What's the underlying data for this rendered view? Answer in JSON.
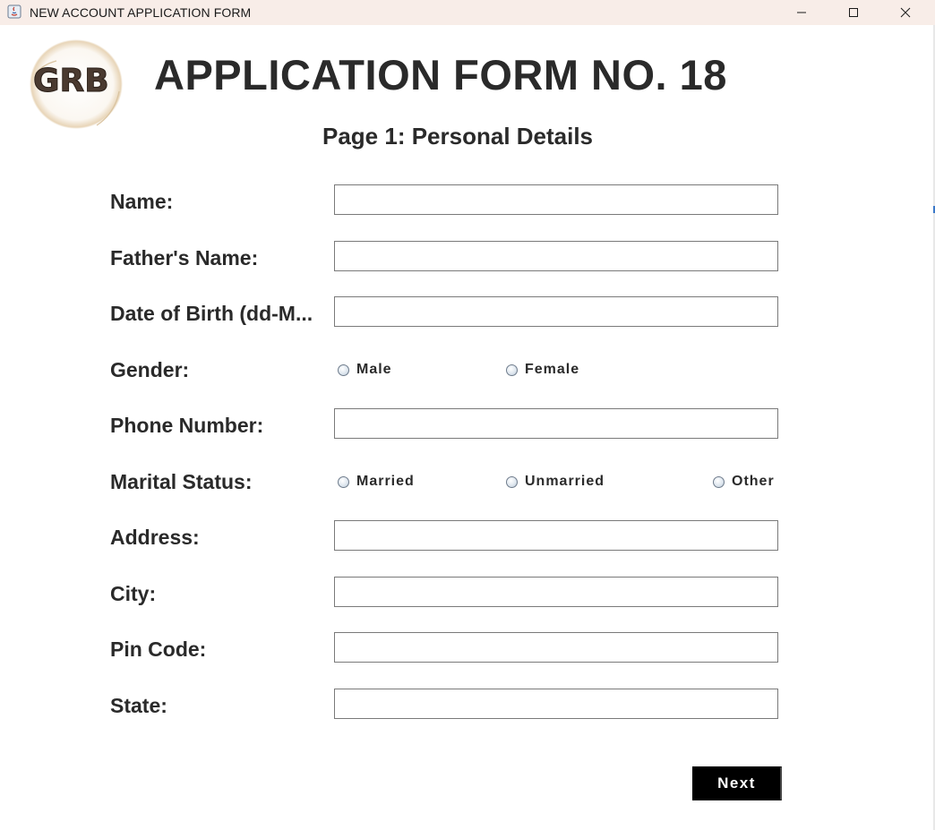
{
  "window": {
    "title": "NEW ACCOUNT APPLICATION FORM",
    "controls": [
      "minimize-icon",
      "maximize-icon",
      "close-icon"
    ]
  },
  "header": {
    "logo_text": "GRB",
    "title": "APPLICATION FORM NO. 18",
    "subtitle": "Page 1: Personal Details"
  },
  "form": {
    "labels": {
      "name": "Name:",
      "father_name": "Father's Name:",
      "dob": "Date of Birth (dd-M...",
      "gender": "Gender:",
      "phone": "Phone Number:",
      "marital": "Marital Status:",
      "address": "Address:",
      "city": "City:",
      "pin": "Pin Code:",
      "state": "State:"
    },
    "values": {
      "name": "",
      "father_name": "",
      "dob": "",
      "phone": "",
      "address": "",
      "city": "",
      "pin": "",
      "state": ""
    },
    "gender_options": [
      "Male",
      "Female"
    ],
    "marital_options": [
      "Married",
      "Unmarried",
      "Other"
    ],
    "next_label": "Next"
  },
  "colors": {
    "titlebar_bg": "#f8ede8",
    "text": "#2a2a2a",
    "button_bg": "#000000",
    "button_text": "#ffffff"
  }
}
